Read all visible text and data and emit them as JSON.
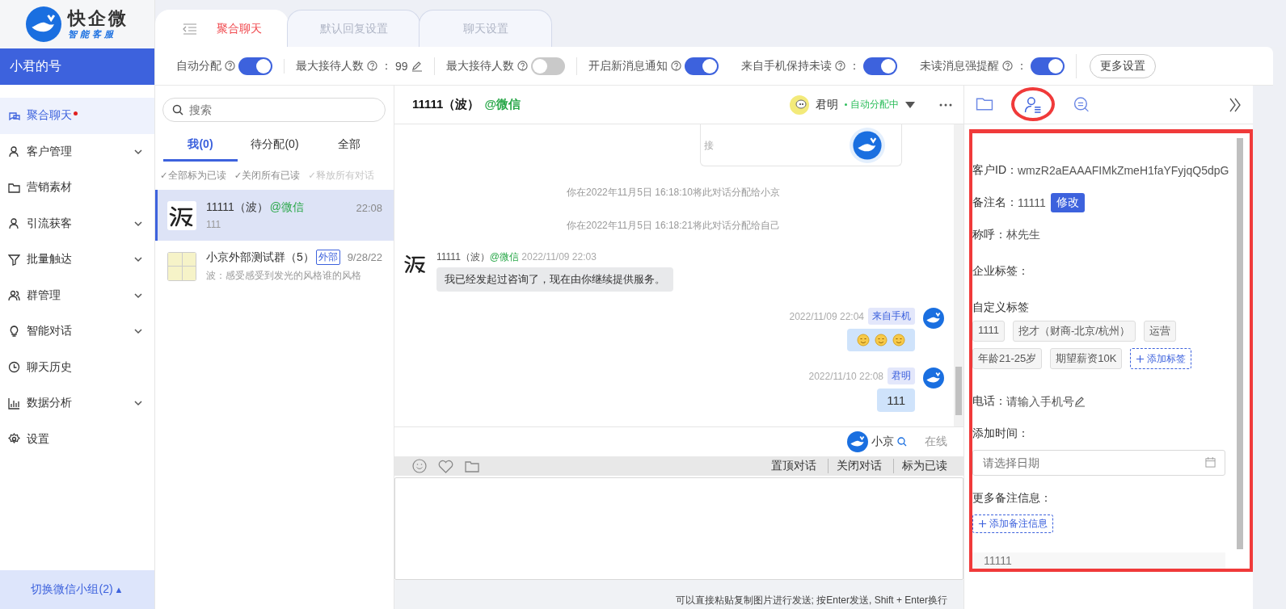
{
  "logo": {
    "name": "快企微",
    "tagline": "智能客服"
  },
  "account": "小君的号",
  "nav": [
    {
      "label": "聚合聊天",
      "selected": true,
      "unread": true,
      "expandable": false
    },
    {
      "label": "客户管理",
      "selected": false,
      "unread": false,
      "expandable": true
    },
    {
      "label": "营销素材",
      "selected": false,
      "unread": false,
      "expandable": false
    },
    {
      "label": "引流获客",
      "selected": false,
      "unread": false,
      "expandable": true
    },
    {
      "label": "批量触达",
      "selected": false,
      "unread": false,
      "expandable": true
    },
    {
      "label": "群管理",
      "selected": false,
      "unread": false,
      "expandable": true
    },
    {
      "label": "智能对话",
      "selected": false,
      "unread": false,
      "expandable": true
    },
    {
      "label": "聊天历史",
      "selected": false,
      "unread": false,
      "expandable": false
    },
    {
      "label": "数据分析",
      "selected": false,
      "unread": false,
      "expandable": true
    },
    {
      "label": "设置",
      "selected": false,
      "unread": false,
      "expandable": false
    }
  ],
  "group_switch": {
    "label": "切换微信小组(2)",
    "caret": "▲"
  },
  "tabs": [
    {
      "label": "聚合聊天",
      "selected": true
    },
    {
      "label": "默认回复设置",
      "selected": false
    },
    {
      "label": "聊天设置",
      "selected": false
    }
  ],
  "settings": [
    {
      "kind": "toggle",
      "label": "自动分配",
      "on": true
    },
    {
      "kind": "value",
      "label": "最大接待人数",
      "suffix": "：",
      "value": "99"
    },
    {
      "kind": "toggle",
      "label": "最大接待人数",
      "on": false
    },
    {
      "kind": "toggle",
      "label": "开启新消息通知",
      "on": true
    },
    {
      "kind": "toggle",
      "label": "来自手机保持未读",
      "suffix": "：",
      "on": true
    },
    {
      "kind": "toggle",
      "label": "未读消息强提醒",
      "suffix": "：",
      "on": true
    }
  ],
  "more_settings": "更多设置",
  "conversations": {
    "search_placeholder": "搜索",
    "filters": [
      {
        "label": "我(0)",
        "selected": true
      },
      {
        "label": "待分配(0)",
        "selected": false
      },
      {
        "label": "全部",
        "selected": false
      }
    ],
    "actions": [
      {
        "label": "✓全部标为已读",
        "disabled": false
      },
      {
        "label": "✓关闭所有已读",
        "disabled": false
      },
      {
        "label": "✓释放所有对话",
        "disabled": true
      }
    ],
    "items": [
      {
        "kind": "contact",
        "name": "11111（波）",
        "channel": "@微信",
        "time": "22:08",
        "preview": "111",
        "selected": true
      },
      {
        "kind": "group",
        "name": "小京外部测试群（5）",
        "tag": "外部",
        "time": "9/28/22",
        "preview": "波：感受感受到发光的风格谁的风格",
        "selected": false
      }
    ]
  },
  "chat": {
    "title": "11111（波）",
    "channel": "@微信",
    "agent": {
      "name": "君明",
      "status": "自动分配中"
    },
    "card_text": "接",
    "messages": [
      {
        "kind": "system",
        "text": "你在2022年11月5日 16:18:10将此对话分配给小京"
      },
      {
        "kind": "system",
        "text": "你在2022年11月5日 16:18:21将此对话分配给自己"
      },
      {
        "kind": "incoming",
        "sender": "11111（波）",
        "channel": "@微信",
        "time": "2022/11/09 22:03",
        "text": "我已经发起过咨询了，现在由你继续提供服务。"
      },
      {
        "kind": "sticker",
        "time": "2022/11/09 22:04",
        "badge": "来自手机"
      },
      {
        "kind": "outgoing",
        "time": "2022/11/10 22:08",
        "badge": "君明",
        "text": "111"
      }
    ],
    "presence": {
      "name": "小京",
      "status": "在线"
    },
    "actions": [
      "置顶对话",
      "关闭对话",
      "标为已读"
    ],
    "hint": "可以直接粘贴复制图片进行发送; 按Enter发送, Shift + Enter换行"
  },
  "customer": {
    "tabs": [
      {
        "selected": false
      },
      {
        "selected": true
      },
      {
        "selected": false
      }
    ],
    "fields": [
      {
        "kind": "text",
        "label": "客户ID：",
        "value": "wmzR2aEAAAFIMkZmeH1faYFyjqQ5dpG"
      },
      {
        "kind": "editable",
        "label": "备注名：",
        "value": "11111",
        "button": "修改"
      },
      {
        "kind": "text",
        "label": "称呼：",
        "value": "林先生"
      },
      {
        "kind": "tags",
        "label": "企业标签："
      },
      {
        "kind": "tags",
        "label": "自定义标签",
        "tags": [
          "1111",
          "挖才（财商-北京/杭州）",
          "运营",
          "年龄21-25岁",
          "期望薪资10K"
        ],
        "add": "添加标签"
      },
      {
        "kind": "phone",
        "label": "电话：",
        "placeholder": "请输入手机号"
      },
      {
        "kind": "date",
        "label": "添加时间：",
        "placeholder": "请选择日期"
      },
      {
        "kind": "notes",
        "label": "更多备注信息：",
        "add": "添加备注信息",
        "note": "11111"
      }
    ]
  }
}
